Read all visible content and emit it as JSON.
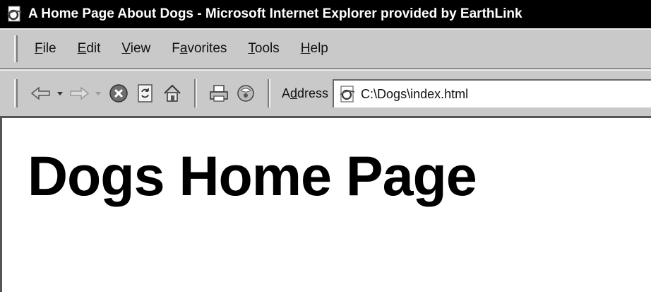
{
  "window": {
    "title": "A Home Page About Dogs - Microsoft Internet Explorer provided by EarthLink"
  },
  "menu": {
    "items": [
      {
        "accel": "F",
        "rest": "ile"
      },
      {
        "accel": "E",
        "rest": "dit"
      },
      {
        "accel": "V",
        "rest": "iew"
      },
      {
        "pre": "F",
        "accel": "a",
        "rest": "vorites"
      },
      {
        "accel": "T",
        "rest": "ools"
      },
      {
        "accel": "H",
        "rest": "elp"
      }
    ]
  },
  "toolbar": {
    "address_label_pre": "A",
    "address_label_accel": "d",
    "address_label_rest": "dress",
    "address_value": "C:\\Dogs\\index.html",
    "icons": [
      "back-arrow-icon",
      "dropdown-arrow-icon",
      "forward-arrow-icon",
      "dropdown-arrow-icon",
      "stop-icon",
      "refresh-icon",
      "home-icon",
      "print-icon",
      "media-icon",
      "ie-page-icon"
    ]
  },
  "page": {
    "heading": "Dogs Home Page"
  },
  "colors": {
    "titlebar": "#000000",
    "chrome": "#c9c9c9",
    "content": "#ffffff"
  }
}
